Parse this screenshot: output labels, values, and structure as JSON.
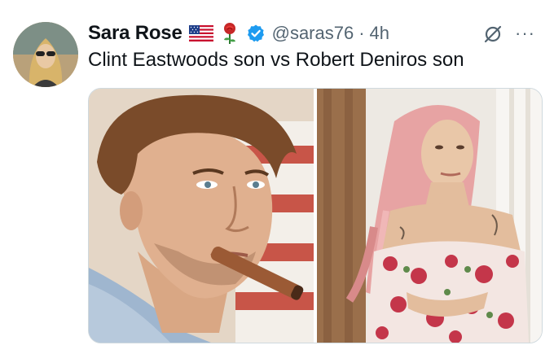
{
  "tweet": {
    "author_name": "Sara Rose",
    "handle": "@saras76",
    "separator": "·",
    "time": "4h",
    "text": "Clint Eastwoods son vs Robert Deniros son",
    "more_label": "···"
  },
  "icons": {
    "flag": "us-flag-icon",
    "rose": "rose-icon",
    "verified": "verified-badge-icon",
    "grok": "grok-icon",
    "more": "more-icon"
  },
  "colors": {
    "verified_blue": "#1d9bf0",
    "secondary_text": "#536471",
    "primary_text": "#0f1419"
  }
}
